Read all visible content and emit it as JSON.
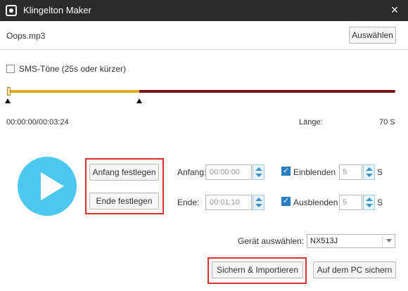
{
  "window": {
    "title": "Klingelton Maker",
    "close_icon": "close-icon",
    "app_icon": "phone-app-icon"
  },
  "file": {
    "name": "Oops.mp3",
    "select_label": "Auswählen"
  },
  "sms": {
    "label": "SMS-Töne (25s oder kürzer)",
    "checked": false
  },
  "timeline": {
    "selection_start_fraction": 0.0,
    "selection_end_fraction": 0.34,
    "played_color": "#e3a91c",
    "remaining_color": "#7a1214"
  },
  "time": {
    "position": "00:00:00/00:03:24",
    "length_label": "Länge:",
    "length_value": "70 S"
  },
  "controls": {
    "play_icon": "play-icon",
    "set_start_label": "Anfang festlegen",
    "set_end_label": "Ende festlegen",
    "start_label": "Anfang:",
    "start_value": "00:00:00",
    "end_label": "Ende:",
    "end_value": "00:01:10",
    "fade_in_label": "Einblenden",
    "fade_in_checked": true,
    "fade_in_value": "5",
    "fade_out_label": "Ausblenden",
    "fade_out_checked": true,
    "fade_out_value": "5",
    "seconds_unit": "S"
  },
  "device": {
    "label": "Gerät auswählen:",
    "selected": "NX513J"
  },
  "actions": {
    "save_import_label": "Sichern & Importieren",
    "save_pc_label": "Auf dem PC sichern"
  },
  "colors": {
    "accent": "#4cc8ef",
    "highlight": "#d93030",
    "titlebar": "#2b2b2b"
  }
}
